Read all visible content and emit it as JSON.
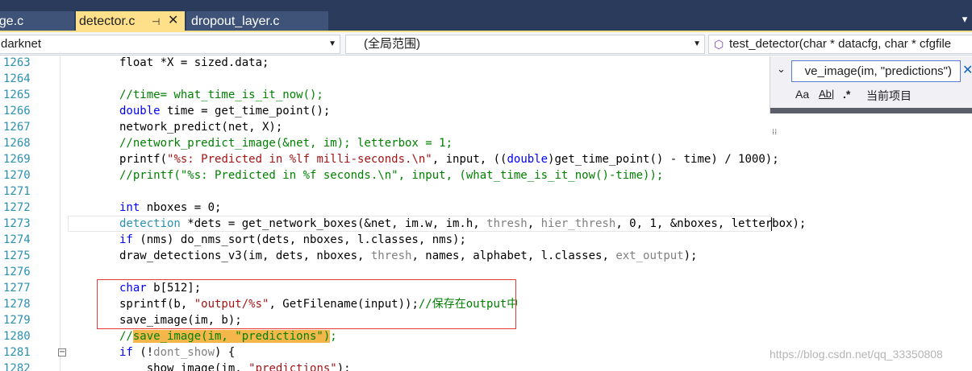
{
  "tabs": [
    {
      "label": "age.c",
      "active": false
    },
    {
      "label": "detector.c",
      "active": true
    },
    {
      "label": "dropout_layer.c",
      "active": false
    }
  ],
  "tab_pin_icon": "pin-icon",
  "tab_close_icon": "close-icon",
  "nav": {
    "project": "darknet",
    "scope": "(全局范围)",
    "function": "test_detector(char * datacfg, char * cfgfile"
  },
  "find": {
    "query": "ve_image(im, \"predictions\")",
    "match_case": "Aa",
    "whole_word": "Ab|",
    "regex": ".*",
    "scope": "当前项目"
  },
  "lines": [
    {
      "no": "1263",
      "tokens": [
        {
          "t": "float *X = sized.data;",
          "c": ""
        }
      ]
    },
    {
      "no": "1264",
      "tokens": []
    },
    {
      "no": "1265",
      "tokens": [
        {
          "t": "//time= what_time_is_it_now();",
          "c": "cm"
        }
      ]
    },
    {
      "no": "1266",
      "tokens": [
        {
          "t": "double",
          "c": "kw"
        },
        {
          "t": " time = get_time_point();",
          "c": ""
        }
      ]
    },
    {
      "no": "1267",
      "tokens": [
        {
          "t": "network_predict(net, X);",
          "c": ""
        }
      ]
    },
    {
      "no": "1268",
      "tokens": [
        {
          "t": "//network_predict_image(&net, im); letterbox = 1;",
          "c": "cm"
        }
      ]
    },
    {
      "no": "1269",
      "tokens": [
        {
          "t": "printf(",
          "c": ""
        },
        {
          "t": "\"%s: Predicted in %lf milli-seconds.\\n\"",
          "c": "st"
        },
        {
          "t": ", input, ((",
          "c": ""
        },
        {
          "t": "double",
          "c": "kw"
        },
        {
          "t": ")get_time_point() - time) / 1000);",
          "c": ""
        }
      ]
    },
    {
      "no": "1270",
      "tokens": [
        {
          "t": "//printf(\"%s: Predicted in %f seconds.\\n\", input, (what_time_is_it_now()-time));",
          "c": "cm"
        }
      ]
    },
    {
      "no": "1271",
      "tokens": []
    },
    {
      "no": "1272",
      "tokens": [
        {
          "t": "int",
          "c": "kw"
        },
        {
          "t": " nboxes = 0;",
          "c": ""
        }
      ]
    },
    {
      "no": "1273",
      "tokens": [
        {
          "t": "detection",
          "c": "ty"
        },
        {
          "t": " *dets = get_network_boxes(&net, im.w, im.h, ",
          "c": ""
        },
        {
          "t": "thresh",
          "c": "gr"
        },
        {
          "t": ", ",
          "c": ""
        },
        {
          "t": "hier_thresh",
          "c": "gr"
        },
        {
          "t": ", 0, 1, &nboxes, letterbox);",
          "c": ""
        }
      ]
    },
    {
      "no": "1274",
      "tokens": [
        {
          "t": "if",
          "c": "kw"
        },
        {
          "t": " (nms) do_nms_sort(dets, nboxes, l.classes, nms);",
          "c": ""
        }
      ]
    },
    {
      "no": "1275",
      "tokens": [
        {
          "t": "draw_detections_v3(im, dets, nboxes, ",
          "c": ""
        },
        {
          "t": "thresh",
          "c": "gr"
        },
        {
          "t": ", names, alphabet, l.classes, ",
          "c": ""
        },
        {
          "t": "ext_output",
          "c": "gr"
        },
        {
          "t": ");",
          "c": ""
        }
      ]
    },
    {
      "no": "1276",
      "tokens": []
    },
    {
      "no": "1277",
      "tokens": [
        {
          "t": "char",
          "c": "kw"
        },
        {
          "t": " b[512];",
          "c": ""
        }
      ]
    },
    {
      "no": "1278",
      "tokens": [
        {
          "t": "sprintf(b, ",
          "c": ""
        },
        {
          "t": "\"output/%s\"",
          "c": "st"
        },
        {
          "t": ", GetFilename(input));",
          "c": ""
        },
        {
          "t": "//保存在output中",
          "c": "cm"
        }
      ]
    },
    {
      "no": "1279",
      "tokens": [
        {
          "t": "save_image(im, b);",
          "c": ""
        }
      ]
    },
    {
      "no": "1280",
      "tokens": [
        {
          "t": "//",
          "c": "cm"
        },
        {
          "t": "save_image(im, \"predictions\")",
          "c": "cm hl"
        },
        {
          "t": ";",
          "c": "cm"
        }
      ]
    },
    {
      "no": "1281",
      "tokens": [
        {
          "t": "if",
          "c": "kw"
        },
        {
          "t": " (!",
          "c": ""
        },
        {
          "t": "dont_show",
          "c": "gr"
        },
        {
          "t": ") {",
          "c": ""
        }
      ]
    },
    {
      "no": "1282",
      "tokens": [
        {
          "t": "    show_image(im, ",
          "c": ""
        },
        {
          "t": "\"predictions\"",
          "c": "st"
        },
        {
          "t": ");",
          "c": ""
        }
      ]
    }
  ],
  "watermark": "https://blog.csdn.net/qq_33350808"
}
